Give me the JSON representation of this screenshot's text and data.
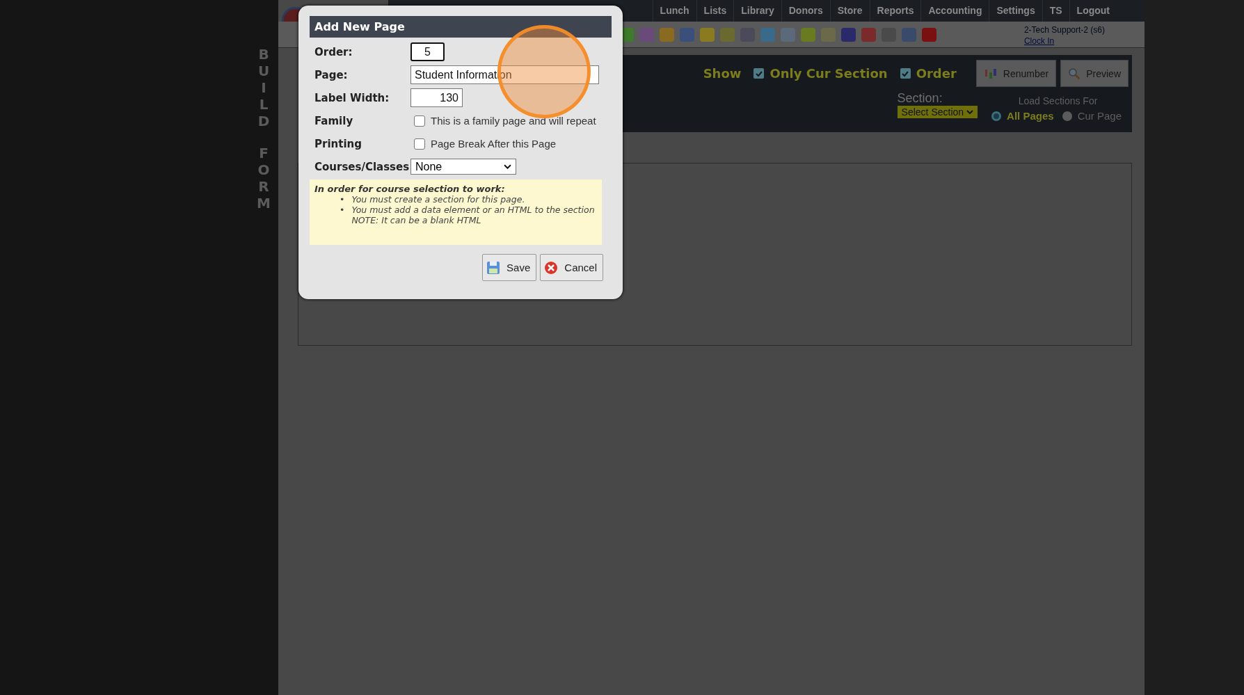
{
  "sidebar": {
    "vertical_title": [
      "BUILD",
      "FORM"
    ]
  },
  "nav": {
    "items": [
      "Lunch",
      "Lists",
      "Library",
      "Donors",
      "Store",
      "Reports",
      "Accounting",
      "Settings",
      "TS",
      "Logout"
    ]
  },
  "user": {
    "name": "2-Tech Support-2 (s6)",
    "link": "Clock In"
  },
  "panel": {
    "show_label": "Show",
    "options": [
      {
        "label": "Only Cur Section",
        "checked": true
      },
      {
        "label": "Order",
        "checked": true
      }
    ],
    "buttons": [
      {
        "kind": "renumber",
        "label": "Renumber"
      },
      {
        "kind": "preview",
        "label": "Preview"
      }
    ],
    "section_label": "Section:",
    "section_select": "Select Section",
    "load_label": "Load Sections For",
    "load_options": [
      {
        "label": "All Pages",
        "selected": true
      },
      {
        "label": "Cur Page",
        "selected": false
      }
    ]
  },
  "dialog": {
    "title": "Add New Page",
    "fields": [
      {
        "kind": "short-text",
        "label": "Order:",
        "value": "5"
      },
      {
        "kind": "text",
        "label": "Page:",
        "value": "Student Information"
      },
      {
        "kind": "number",
        "label": "Label Width:",
        "value": "130"
      },
      {
        "kind": "checkbox",
        "label": "Family",
        "text": "This is a family page and will repeat",
        "checked": false
      },
      {
        "kind": "checkbox",
        "label": "Printing",
        "text": "Page Break After this Page",
        "checked": false
      },
      {
        "kind": "select",
        "label": "Courses/Classes",
        "value": "None"
      }
    ],
    "note": {
      "heading": "In order for course selection to work:",
      "items": [
        {
          "marker": "•",
          "lines": [
            "You must create a section for this page."
          ]
        },
        {
          "marker": "•",
          "lines": [
            "You must add a data element or an HTML to the section",
            "NOTE: It can be a blank HTML"
          ]
        }
      ]
    },
    "buttons": [
      {
        "kind": "save",
        "label": "Save"
      },
      {
        "kind": "cancel",
        "label": "Cancel"
      }
    ]
  }
}
